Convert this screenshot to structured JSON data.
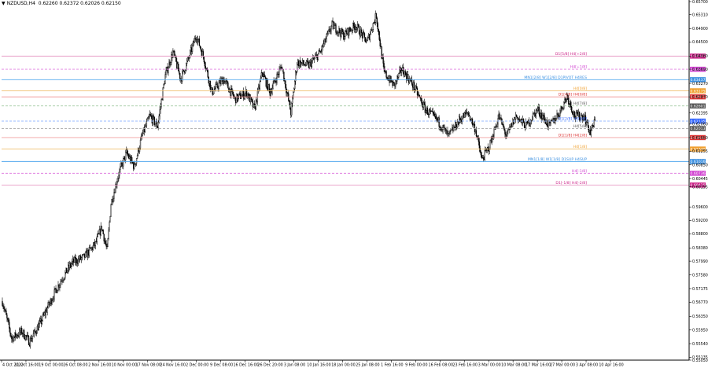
{
  "header": {
    "symbol": "NZDUSD,H4",
    "ohlc": "0.62260 0.62372 0.62026 0.62150"
  },
  "chart_data": {
    "type": "candlestick",
    "ylim": [
      0.5505,
      0.657
    ],
    "y_ticks": [
      "0.65700",
      "0.65310",
      "0.64900",
      "0.64500",
      "0.64080",
      "0.63690",
      "0.63270",
      "0.62870",
      "0.62395",
      "0.62060",
      "0.61660",
      "0.61255",
      "0.60850",
      "0.60445",
      "0.60195",
      "0.59600",
      "0.59200",
      "0.58800",
      "0.58380",
      "0.57990",
      "0.57580",
      "0.57175",
      "0.56770",
      "0.56350",
      "0.55950",
      "0.55540",
      "0.55135",
      "0.55050"
    ],
    "x_labels": [
      "4 Oct 2022",
      "11 Oct 16:00",
      "19 Oct 00:00",
      "26 Oct 08:00",
      "2 Nov 16:00",
      "10 Nov 00:00",
      "17 Nov 08:00",
      "24 Nov 16:00",
      "2 Dec 00:00",
      "9 Dec 08:00",
      "16 Dec 16:00",
      "26 Dec 20:00",
      "3 Jan 08:00",
      "10 Jan 16:00",
      "18 Jan 00:00",
      "25 Jan 08:00",
      "1 Feb 16:00",
      "9 Feb 00:00",
      "16 Feb 08:00",
      "23 Feb 16:00",
      "3 Mar 00:00",
      "10 Mar 08:00",
      "17 Mar 16:00",
      "27 Mar 00:00",
      "3 Apr 08:00",
      "10 Apr 16:00"
    ],
    "price_path": [
      {
        "i": 0,
        "p": 0.568
      },
      {
        "i": 12,
        "p": 0.557
      },
      {
        "i": 25,
        "p": 0.559
      },
      {
        "i": 35,
        "p": 0.556
      },
      {
        "i": 50,
        "p": 0.562
      },
      {
        "i": 60,
        "p": 0.567
      },
      {
        "i": 75,
        "p": 0.574
      },
      {
        "i": 90,
        "p": 0.5795
      },
      {
        "i": 105,
        "p": 0.581
      },
      {
        "i": 120,
        "p": 0.585
      },
      {
        "i": 128,
        "p": 0.59
      },
      {
        "i": 135,
        "p": 0.583
      },
      {
        "i": 140,
        "p": 0.597
      },
      {
        "i": 150,
        "p": 0.606
      },
      {
        "i": 160,
        "p": 0.612
      },
      {
        "i": 170,
        "p": 0.608
      },
      {
        "i": 180,
        "p": 0.617
      },
      {
        "i": 190,
        "p": 0.623
      },
      {
        "i": 200,
        "p": 0.62
      },
      {
        "i": 210,
        "p": 0.635
      },
      {
        "i": 220,
        "p": 0.642
      },
      {
        "i": 230,
        "p": 0.634
      },
      {
        "i": 240,
        "p": 0.64
      },
      {
        "i": 250,
        "p": 0.647
      },
      {
        "i": 260,
        "p": 0.64
      },
      {
        "i": 270,
        "p": 0.63
      },
      {
        "i": 285,
        "p": 0.634
      },
      {
        "i": 300,
        "p": 0.628
      },
      {
        "i": 315,
        "p": 0.63
      },
      {
        "i": 325,
        "p": 0.625
      },
      {
        "i": 335,
        "p": 0.636
      },
      {
        "i": 345,
        "p": 0.63
      },
      {
        "i": 360,
        "p": 0.638
      },
      {
        "i": 372,
        "p": 0.624
      },
      {
        "i": 380,
        "p": 0.639
      },
      {
        "i": 395,
        "p": 0.638
      },
      {
        "i": 410,
        "p": 0.642
      },
      {
        "i": 425,
        "p": 0.65
      },
      {
        "i": 440,
        "p": 0.647
      },
      {
        "i": 455,
        "p": 0.65
      },
      {
        "i": 470,
        "p": 0.645
      },
      {
        "i": 482,
        "p": 0.653
      },
      {
        "i": 492,
        "p": 0.636
      },
      {
        "i": 505,
        "p": 0.632
      },
      {
        "i": 515,
        "p": 0.637
      },
      {
        "i": 530,
        "p": 0.632
      },
      {
        "i": 545,
        "p": 0.625
      },
      {
        "i": 560,
        "p": 0.622
      },
      {
        "i": 575,
        "p": 0.617
      },
      {
        "i": 590,
        "p": 0.622
      },
      {
        "i": 600,
        "p": 0.624
      },
      {
        "i": 610,
        "p": 0.619
      },
      {
        "i": 618,
        "p": 0.61
      },
      {
        "i": 628,
        "p": 0.614
      },
      {
        "i": 640,
        "p": 0.623
      },
      {
        "i": 650,
        "p": 0.617
      },
      {
        "i": 662,
        "p": 0.623
      },
      {
        "i": 675,
        "p": 0.62
      },
      {
        "i": 690,
        "p": 0.625
      },
      {
        "i": 705,
        "p": 0.62
      },
      {
        "i": 718,
        "p": 0.624
      },
      {
        "i": 728,
        "p": 0.629
      },
      {
        "i": 738,
        "p": 0.623
      },
      {
        "i": 750,
        "p": 0.623
      },
      {
        "i": 758,
        "p": 0.618
      },
      {
        "i": 764,
        "p": 0.6215
      }
    ],
    "levels": [
      {
        "price": 0.6408,
        "color": "#e8a0c8",
        "style": "solid",
        "label": "D1[5/8] H4[+2/8]",
        "tag": "0.64087",
        "tag_color": "#cc2288"
      },
      {
        "price": 0.6369,
        "color": "#e080e0",
        "style": "dashed",
        "label": "H4[+1/8]",
        "tag": "0.63765",
        "tag_color": "#d040d0"
      },
      {
        "price": 0.6338,
        "color": "#55aaee",
        "style": "solid",
        "label": "MN1[2/8] W1[2/8] D1PIVOT H4RES",
        "tag": "0.63437",
        "tag_color": "#3a8fe0"
      },
      {
        "price": 0.6305,
        "color": "#f0c070",
        "style": "solid",
        "label": "H4[0/8]",
        "tag": "0.63175",
        "tag_color": "#f0a030"
      },
      {
        "price": 0.6287,
        "color": "#f09090",
        "style": "solid",
        "label": "D1[4/8] H4[0/8]",
        "tag": "0.62862",
        "tag_color": "#dd3333"
      },
      {
        "price": 0.626,
        "color": "#a0c8a0",
        "style": "dashed",
        "label": "H4[7/8]",
        "tag": "0.62601",
        "tag_color": "#555555"
      },
      {
        "price": 0.6215,
        "color": "#99bbff",
        "style": "dashed",
        "label": "D1[2/8] H4[6/8]",
        "tag": "0.62135",
        "tag_color": "#3366ff"
      },
      {
        "price": 0.6193,
        "color": "#aaaaaa",
        "style": "dashed",
        "label": "H4[5/8]",
        "tag": "0.62013",
        "tag_color": "#555555"
      },
      {
        "price": 0.6166,
        "color": "#f0a0a0",
        "style": "solid",
        "label": "D1[1/8] H4[2/8]",
        "tag": "0.61646",
        "tag_color": "#dd3333"
      },
      {
        "price": 0.6132,
        "color": "#f0c070",
        "style": "solid",
        "label": "H4[1/8]",
        "tag": "0.61340",
        "tag_color": "#f0a030"
      },
      {
        "price": 0.6095,
        "color": "#55aaee",
        "style": "solid",
        "label": "MN1[1/8] W1[1/8] D1SUP H4SUP",
        "tag": "0.61016",
        "tag_color": "#3a8fe0"
      },
      {
        "price": 0.606,
        "color": "#e080e0",
        "style": "dashed",
        "label": "H4[-1/8]",
        "tag": "0.60736",
        "tag_color": "#d040d0"
      },
      {
        "price": 0.6025,
        "color": "#e8a0c8",
        "style": "solid",
        "label": "D1[-1/8] H4[-2/8]",
        "tag": "0.60425",
        "tag_color": "#cc2288"
      }
    ]
  }
}
